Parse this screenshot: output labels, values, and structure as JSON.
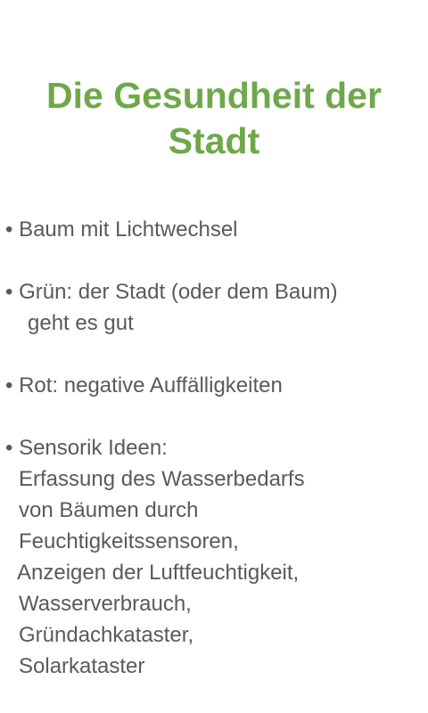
{
  "title": {
    "line1": "Die Gesundheit der",
    "line2": "Stadt"
  },
  "bullets": [
    {
      "lines": [
        "• Baum mit Lichtwechsel"
      ]
    },
    {
      "lines": [
        "• Grün: der Stadt (oder dem Baum)",
        "geht es gut"
      ]
    },
    {
      "lines": [
        "• Rot: negative Auffälligkeiten"
      ]
    },
    {
      "lines": [
        "• Sensorik Ideen:",
        "Erfassung des Wasserbedarfs",
        "von Bäumen durch",
        "Feuchtigkeitssensoren,",
        "Anzeigen der Luftfeuchtigkeit,",
        "Wasserverbrauch,",
        "Gründachkataster,",
        "Solarkataster"
      ]
    }
  ],
  "colors": {
    "title": "#6fa84a",
    "body_text": "#5a5a5a",
    "background": "#ffffff"
  }
}
